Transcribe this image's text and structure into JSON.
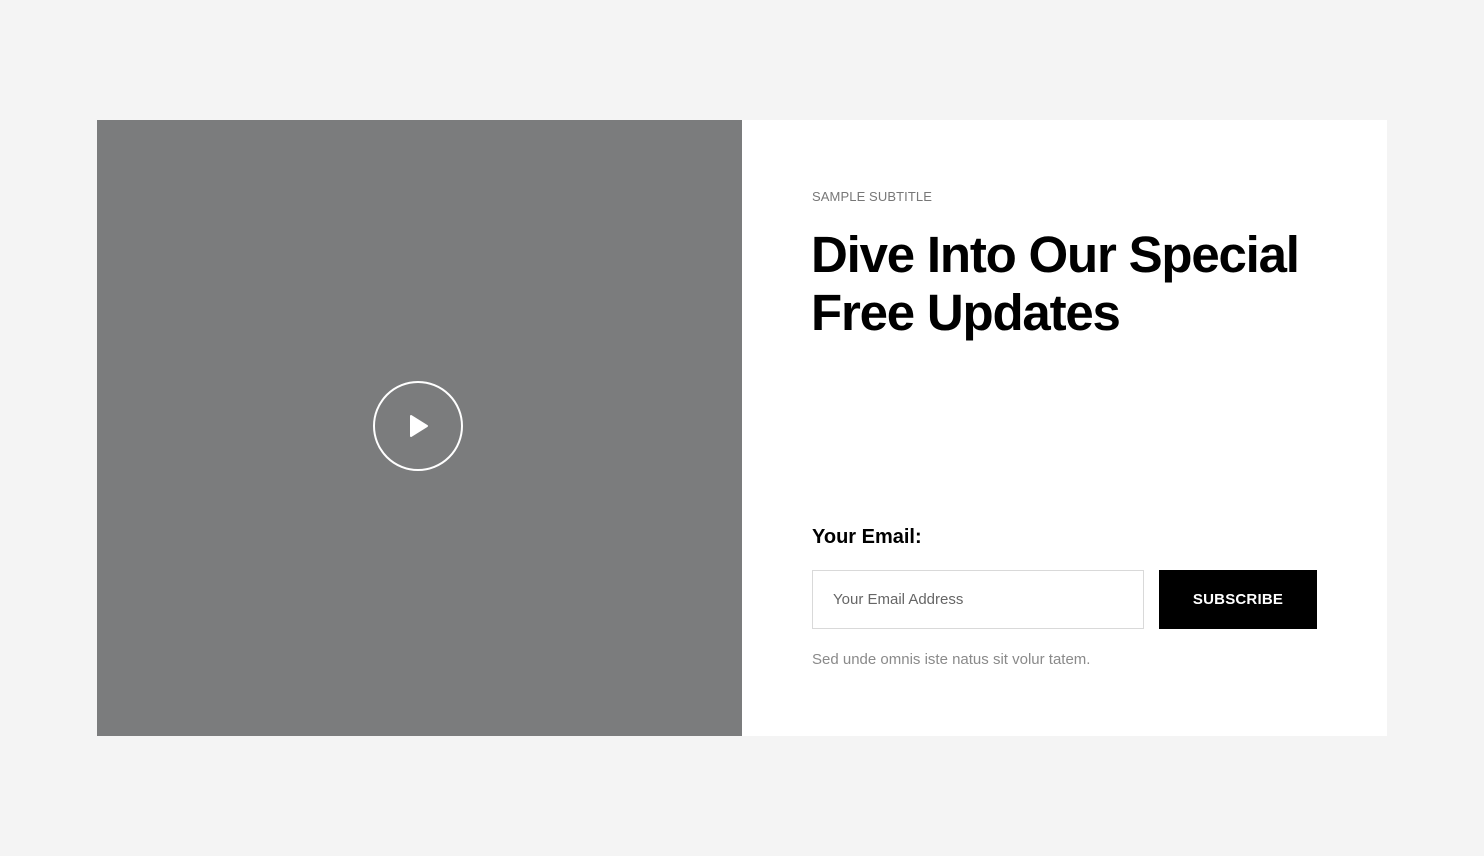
{
  "subtitle": "SAMPLE SUBTITLE",
  "heading": "Dive Into Our Special Free Updates",
  "form": {
    "email_label": "Your Email:",
    "email_placeholder": "Your Email Address",
    "email_value": "",
    "submit_label": "SUBSCRIBE"
  },
  "note": "Sed unde omnis iste natus sit volur tatem.",
  "media": {
    "play_icon": "play-icon"
  },
  "colors": {
    "page_bg": "#f4f4f4",
    "media_bg": "#7b7c7d",
    "button_bg": "#000000",
    "button_text": "#ffffff"
  }
}
